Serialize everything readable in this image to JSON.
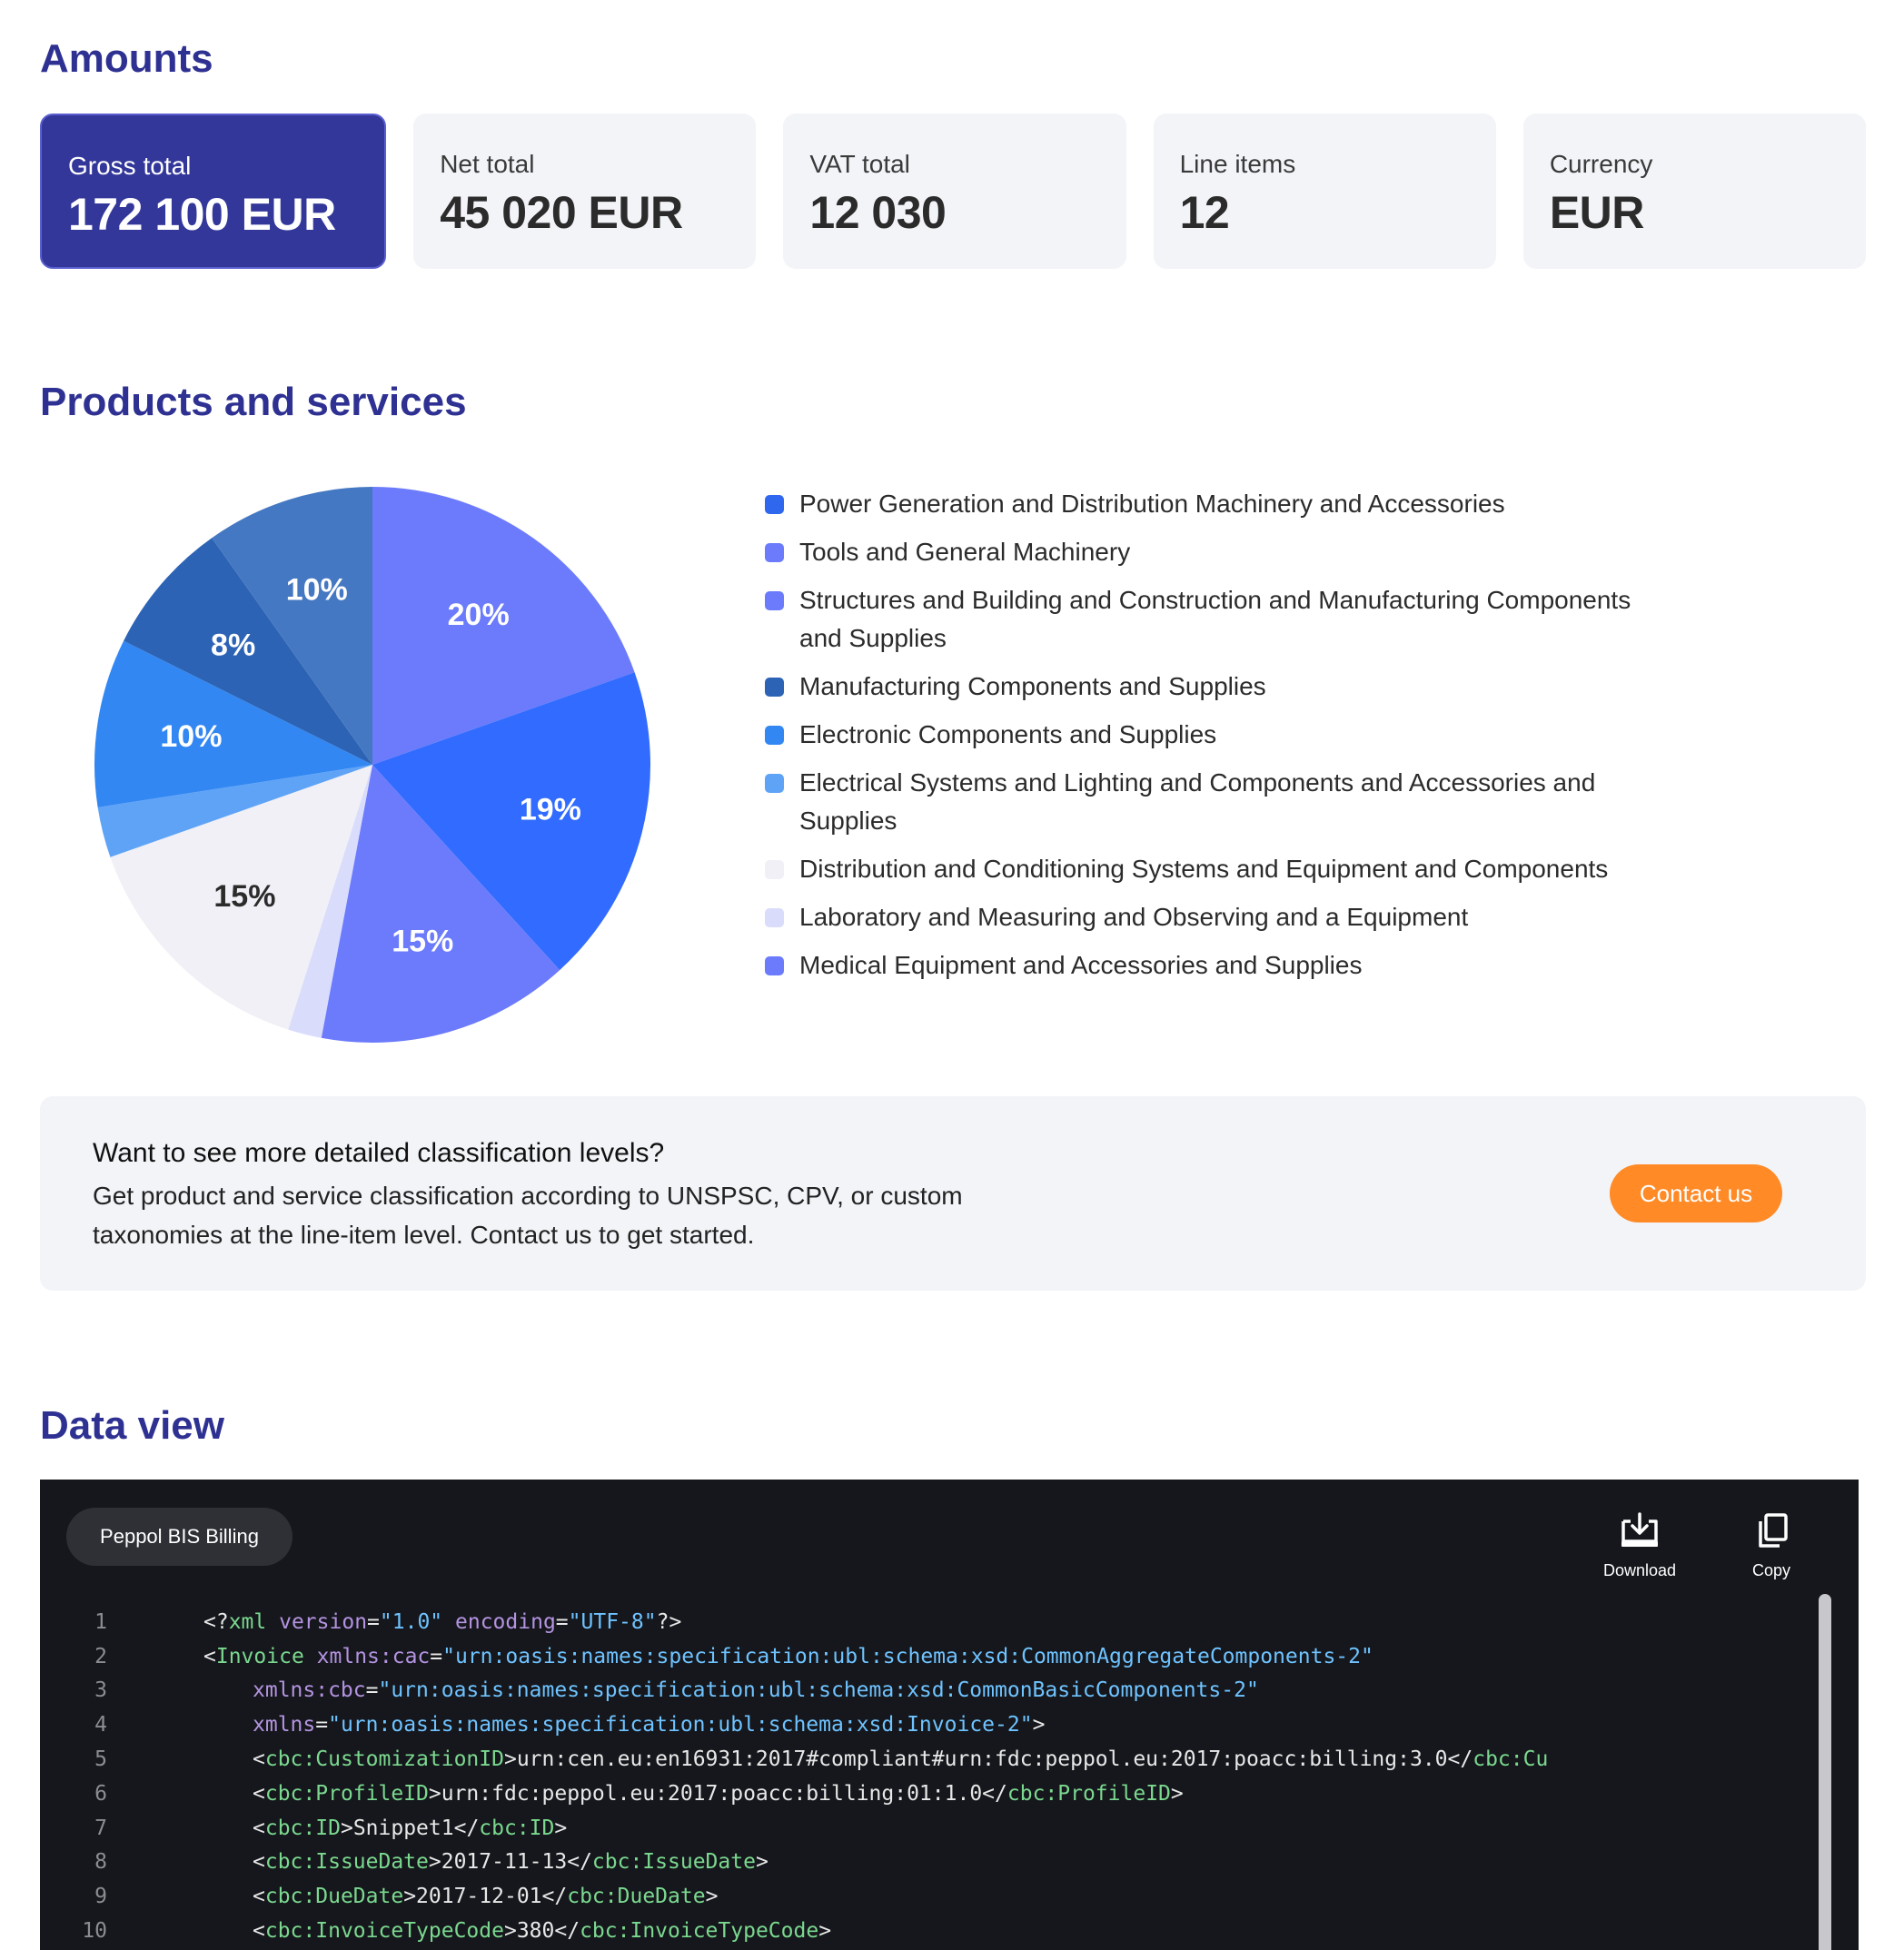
{
  "amounts": {
    "title": "Amounts",
    "cards": [
      {
        "label": "Gross total",
        "value": "172 100 EUR"
      },
      {
        "label": "Net total",
        "value": "45 020 EUR"
      },
      {
        "label": "VAT total",
        "value": "12 030"
      },
      {
        "label": "Line items",
        "value": "12"
      },
      {
        "label": "Currency",
        "value": "EUR"
      }
    ]
  },
  "products": {
    "title": "Products and services"
  },
  "chart_data": {
    "type": "pie",
    "title": "",
    "slices": [
      {
        "name": "Power Generation and Distribution Machinery and Accessories",
        "percent": 20,
        "label": "20%",
        "color": "#6b7bfb"
      },
      {
        "name": "Tools and General Machinery",
        "percent": 19,
        "label": "19%",
        "color": "#316bff"
      },
      {
        "name": "Structures and Building and Construction and Manufacturing Components and Supplies",
        "percent": 15,
        "label": "15%",
        "color": "#6b7bfb"
      },
      {
        "name": "Laboratory and Measuring and Observing and a Equipment",
        "percent": 2,
        "label": "",
        "color": "#d9dcfb"
      },
      {
        "name": "Distribution and Conditioning Systems and Equipment and Components",
        "percent": 15,
        "label": "15%",
        "color": "#f0f0f6"
      },
      {
        "name": "Electrical Systems and Lighting and Components and Accessories and Supplies",
        "percent": 3,
        "label": "",
        "color": "#5fa3f7"
      },
      {
        "name": "Electronic Components and Supplies",
        "percent": 10,
        "label": "10%",
        "color": "#3287f2"
      },
      {
        "name": "Manufacturing Components and Supplies",
        "percent": 8,
        "label": "8%",
        "color": "#2d63b5"
      },
      {
        "name": "Medical Equipment and Accessories and Supplies",
        "percent": 10,
        "label": "10%",
        "color": "#4578c2"
      }
    ],
    "legend_position": "right"
  },
  "legend": [
    {
      "label": "Power Generation and Distribution Machinery and Accessories",
      "color": "#2f68ee"
    },
    {
      "label": "Tools and General Machinery",
      "color": "#6b7bfb"
    },
    {
      "label": "Structures and Building and Construction and Manufacturing Components and Supplies",
      "color": "#6b7bfb"
    },
    {
      "label": "Manufacturing Components and Supplies",
      "color": "#2d63b5"
    },
    {
      "label": "Electronic Components and Supplies",
      "color": "#3287f2"
    },
    {
      "label": "Electrical Systems and Lighting and Components and Accessories and Supplies",
      "color": "#5fa3f7"
    },
    {
      "label": "Distribution and Conditioning Systems and Equipment and Components",
      "color": "#f0f0f6"
    },
    {
      "label": "Laboratory and Measuring and Observing and a Equipment",
      "color": "#d9dcfb"
    },
    {
      "label": "Medical Equipment and Accessories and Supplies",
      "color": "#6b7bfb"
    }
  ],
  "promo": {
    "title": "Want to see more detailed classification levels?",
    "text": "Get product and service classification according to UNSPSC, CPV, or custom taxonomies at the line-item level. Contact us to get started.",
    "button": "Contact us",
    "button_color": "#ff8a26"
  },
  "data_view": {
    "title": "Data view",
    "format": "Peppol BIS Billing",
    "download_label": "Download",
    "copy_label": "Copy",
    "lines": [
      {
        "n": "1",
        "indent": 1,
        "parts": [
          [
            "punc",
            "<?"
          ],
          [
            "tag",
            "xml"
          ],
          [
            "punc",
            " "
          ],
          [
            "attr",
            "version"
          ],
          [
            "punc",
            "="
          ],
          [
            "val",
            "\"1.0\""
          ],
          [
            "punc",
            " "
          ],
          [
            "attr",
            "encoding"
          ],
          [
            "punc",
            "="
          ],
          [
            "val",
            "\"UTF-8\""
          ],
          [
            "punc",
            "?>"
          ]
        ]
      },
      {
        "n": "2",
        "indent": 1,
        "parts": [
          [
            "punc",
            "<"
          ],
          [
            "tag",
            "Invoice"
          ],
          [
            "punc",
            " "
          ],
          [
            "attr",
            "xmlns:cac"
          ],
          [
            "punc",
            "="
          ],
          [
            "val",
            "\"urn:oasis:names:specification:ubl:schema:xsd:CommonAggregateComponents-2\""
          ]
        ]
      },
      {
        "n": "3",
        "indent": 2,
        "parts": [
          [
            "attr",
            "xmlns:cbc"
          ],
          [
            "punc",
            "="
          ],
          [
            "val",
            "\"urn:oasis:names:specification:ubl:schema:xsd:CommonBasicComponents-2\""
          ]
        ]
      },
      {
        "n": "4",
        "indent": 2,
        "parts": [
          [
            "attr",
            "xmlns"
          ],
          [
            "punc",
            "="
          ],
          [
            "val",
            "\"urn:oasis:names:specification:ubl:schema:xsd:Invoice-2\""
          ],
          [
            "punc",
            ">"
          ]
        ]
      },
      {
        "n": "5",
        "indent": 2,
        "parts": [
          [
            "punc",
            "<"
          ],
          [
            "tag",
            "cbc:CustomizationID"
          ],
          [
            "punc",
            ">"
          ],
          [
            "txt",
            "urn:cen.eu:en16931:2017#compliant#urn:fdc:peppol.eu:2017:poacc:billing:3.0"
          ],
          [
            "punc",
            "</"
          ],
          [
            "tag",
            "cbc:Cu"
          ]
        ]
      },
      {
        "n": "6",
        "indent": 2,
        "parts": [
          [
            "punc",
            "<"
          ],
          [
            "tag",
            "cbc:ProfileID"
          ],
          [
            "punc",
            ">"
          ],
          [
            "txt",
            "urn:fdc:peppol.eu:2017:poacc:billing:01:1.0"
          ],
          [
            "punc",
            "</"
          ],
          [
            "tag",
            "cbc:ProfileID"
          ],
          [
            "punc",
            ">"
          ]
        ]
      },
      {
        "n": "7",
        "indent": 2,
        "parts": [
          [
            "punc",
            "<"
          ],
          [
            "tag",
            "cbc:ID"
          ],
          [
            "punc",
            ">"
          ],
          [
            "txt",
            "Snippet1"
          ],
          [
            "punc",
            "</"
          ],
          [
            "tag",
            "cbc:ID"
          ],
          [
            "punc",
            ">"
          ]
        ]
      },
      {
        "n": "8",
        "indent": 2,
        "parts": [
          [
            "punc",
            "<"
          ],
          [
            "tag",
            "cbc:IssueDate"
          ],
          [
            "punc",
            ">"
          ],
          [
            "txt",
            "2017-11-13"
          ],
          [
            "punc",
            "</"
          ],
          [
            "tag",
            "cbc:IssueDate"
          ],
          [
            "punc",
            ">"
          ]
        ]
      },
      {
        "n": "9",
        "indent": 2,
        "parts": [
          [
            "punc",
            "<"
          ],
          [
            "tag",
            "cbc:DueDate"
          ],
          [
            "punc",
            ">"
          ],
          [
            "txt",
            "2017-12-01"
          ],
          [
            "punc",
            "</"
          ],
          [
            "tag",
            "cbc:DueDate"
          ],
          [
            "punc",
            ">"
          ]
        ]
      },
      {
        "n": "10",
        "indent": 2,
        "parts": [
          [
            "punc",
            "<"
          ],
          [
            "tag",
            "cbc:InvoiceTypeCode"
          ],
          [
            "punc",
            ">"
          ],
          [
            "txt",
            "380"
          ],
          [
            "punc",
            "</"
          ],
          [
            "tag",
            "cbc:InvoiceTypeCode"
          ],
          [
            "punc",
            ">"
          ]
        ]
      }
    ]
  }
}
